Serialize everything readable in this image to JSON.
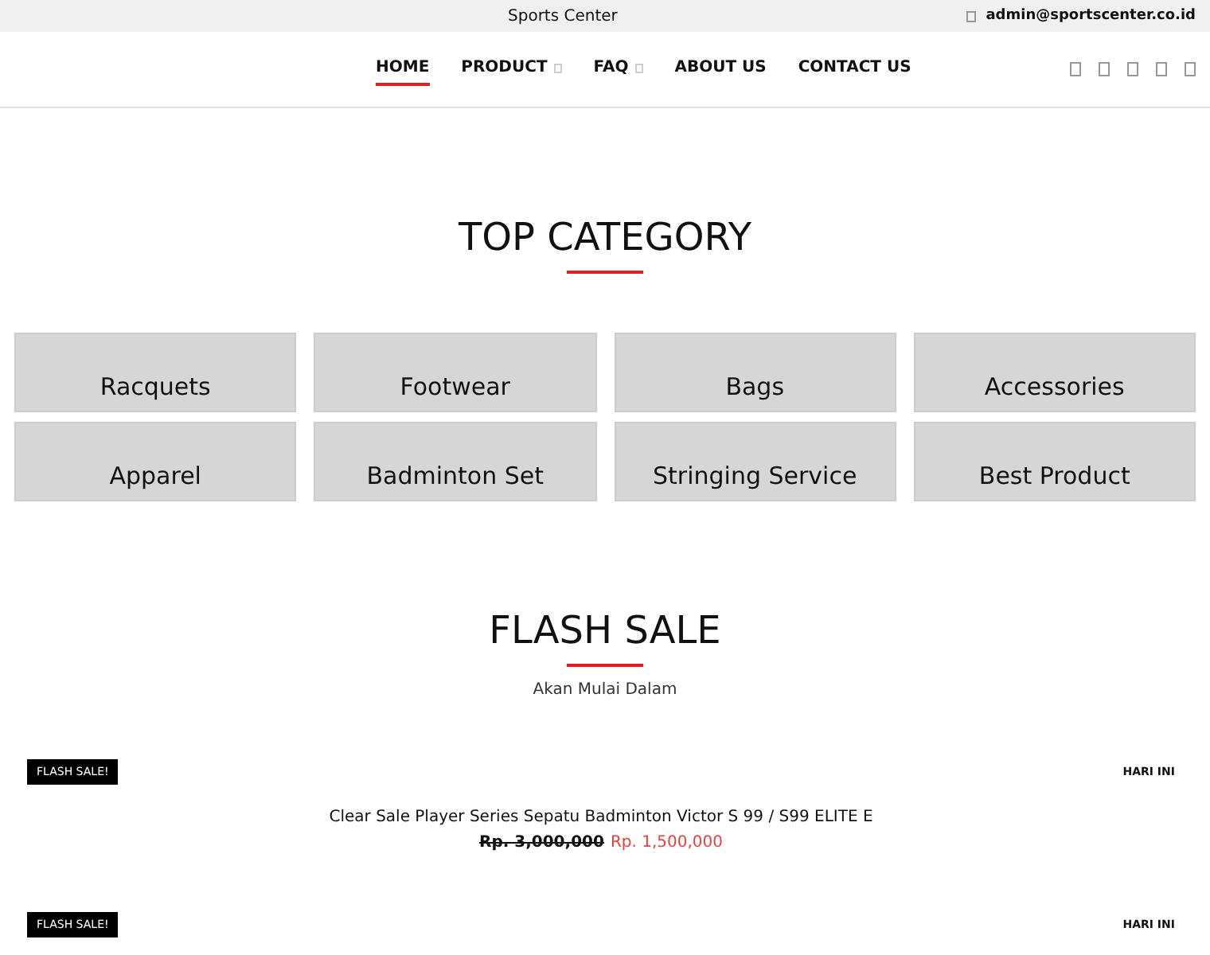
{
  "top_bar": {
    "site_name": "Sports Center",
    "email": "admin@sportscenter.co.id"
  },
  "nav": {
    "items": [
      {
        "label": "HOME",
        "selected": true,
        "dropdown": false
      },
      {
        "label": "PRODUCT",
        "selected": false,
        "dropdown": true
      },
      {
        "label": "FAQ",
        "selected": false,
        "dropdown": true
      },
      {
        "label": "ABOUT US",
        "selected": false,
        "dropdown": false
      },
      {
        "label": "CONTACT US",
        "selected": false,
        "dropdown": false
      }
    ]
  },
  "top_category": {
    "title": "TOP CATEGORY",
    "categories": [
      "Racquets",
      "Footwear",
      "Bags",
      "Accessories",
      "Apparel",
      "Badminton Set",
      "Stringing Service",
      "Best Product"
    ]
  },
  "flash_sale": {
    "title": "FLASH SALE",
    "subtitle": "Akan Mulai Dalam",
    "items": [
      {
        "badge": "FLASH SALE!",
        "day": "HARI INI",
        "name": "Clear Sale Player Series Sepatu Badminton Victor S 99 / S99 ELITE E",
        "old_price": "Rp. 3,000,000",
        "price": "Rp. 1,500,000"
      },
      {
        "badge": "FLASH SALE!",
        "day": "HARI INI"
      }
    ]
  }
}
